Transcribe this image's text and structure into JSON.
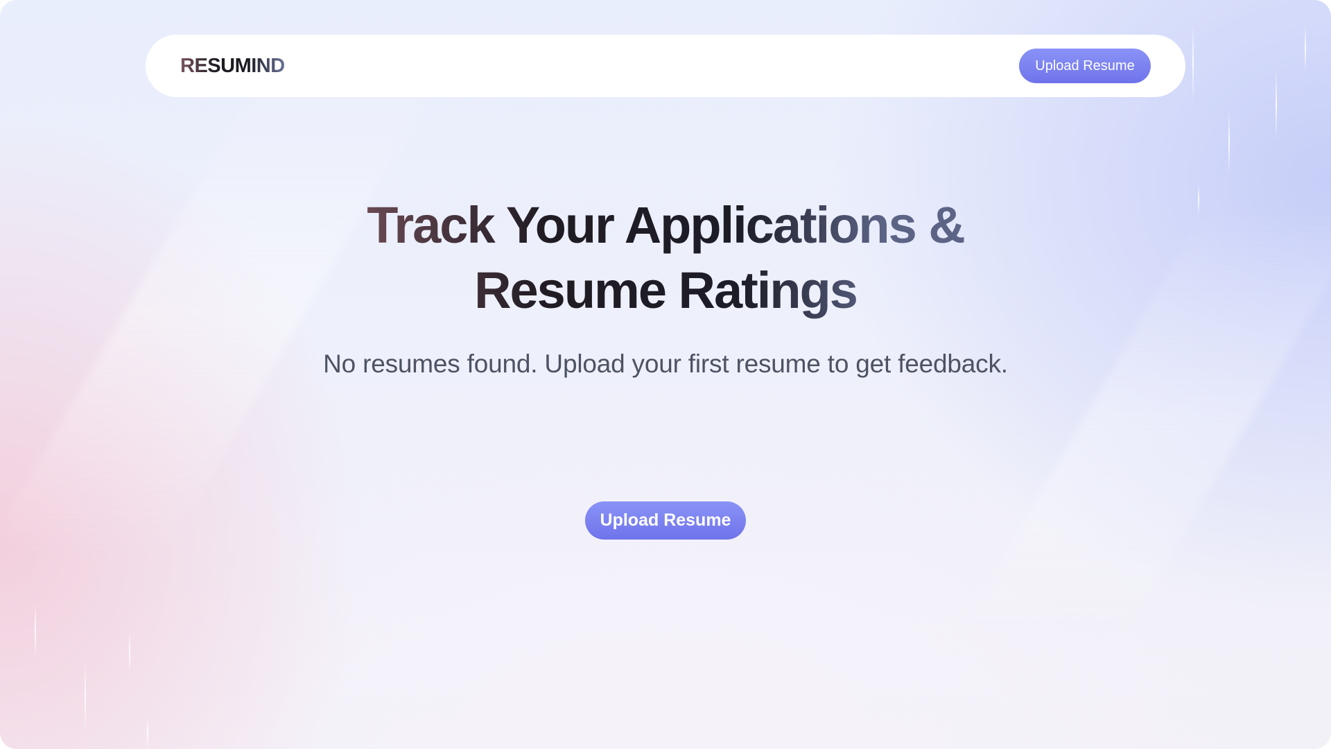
{
  "navbar": {
    "logo": "RESUMIND",
    "upload_label": "Upload Resume"
  },
  "hero": {
    "headline": "Track Your Applications & Resume Ratings",
    "subtitle": "No resumes found. Upload your first resume to get feedback.",
    "upload_label": "Upload Resume"
  },
  "colors": {
    "accent": "#7a80f0",
    "background_top": "#e9eefc",
    "background_pink": "#f4c4d4",
    "background_lavender": "#c4ccf8",
    "text_muted": "#4d5363"
  }
}
